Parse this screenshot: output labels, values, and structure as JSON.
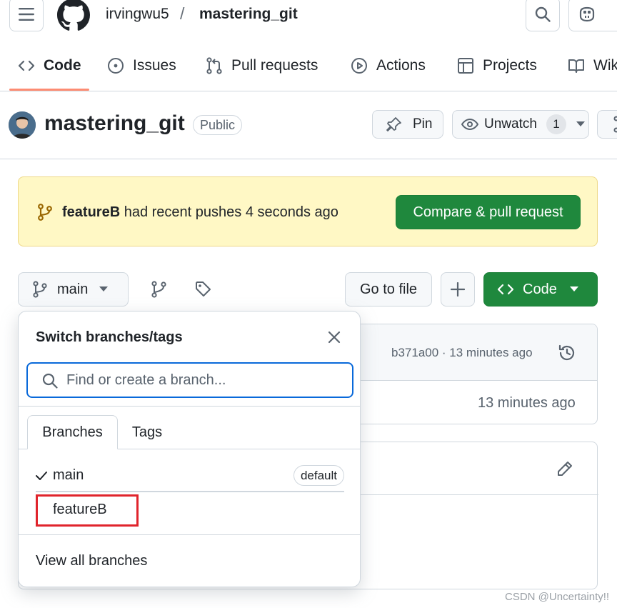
{
  "header": {
    "owner": "irvingwu5",
    "separator": "/",
    "repo": "mastering_git"
  },
  "repo_nav": {
    "items": [
      {
        "label": "Code",
        "icon": "code-icon",
        "selected": true
      },
      {
        "label": "Issues",
        "icon": "issue-opened-icon"
      },
      {
        "label": "Pull requests",
        "icon": "git-pull-request-icon"
      },
      {
        "label": "Actions",
        "icon": "play-icon"
      },
      {
        "label": "Projects",
        "icon": "table-icon"
      },
      {
        "label": "Wik",
        "icon": "book-icon"
      }
    ]
  },
  "repo_title": {
    "name": "mastering_git",
    "visibility": "Public",
    "pin_label": "Pin",
    "watch_label": "Unwatch",
    "watch_count": "1"
  },
  "flash": {
    "branch": "featureB",
    "message": " had recent pushes 4 seconds ago",
    "button": "Compare & pull request"
  },
  "file_nav": {
    "current_branch": "main",
    "go_to_file": "Go to file",
    "code_label": "Code"
  },
  "file_table": {
    "commit_info": "b371a00 · 13 minutes ago",
    "row_time": "13 minutes ago"
  },
  "branch_dropdown": {
    "title": "Switch branches/tags",
    "search_placeholder": "Find or create a branch...",
    "tabs": [
      "Branches",
      "Tags"
    ],
    "branches": [
      {
        "name": "main",
        "checked": true,
        "badge": "default"
      },
      {
        "name": "featureB",
        "checked": false,
        "highlighted": true
      }
    ],
    "view_all": "View all branches"
  },
  "watermark": "CSDN @Uncertainty!!",
  "colors": {
    "accent_green": "#1f883d",
    "flash_bg": "#fff8c5",
    "focus_blue": "#0969da",
    "nav_underline": "#fd8c73",
    "highlight_red": "#e0242c"
  }
}
